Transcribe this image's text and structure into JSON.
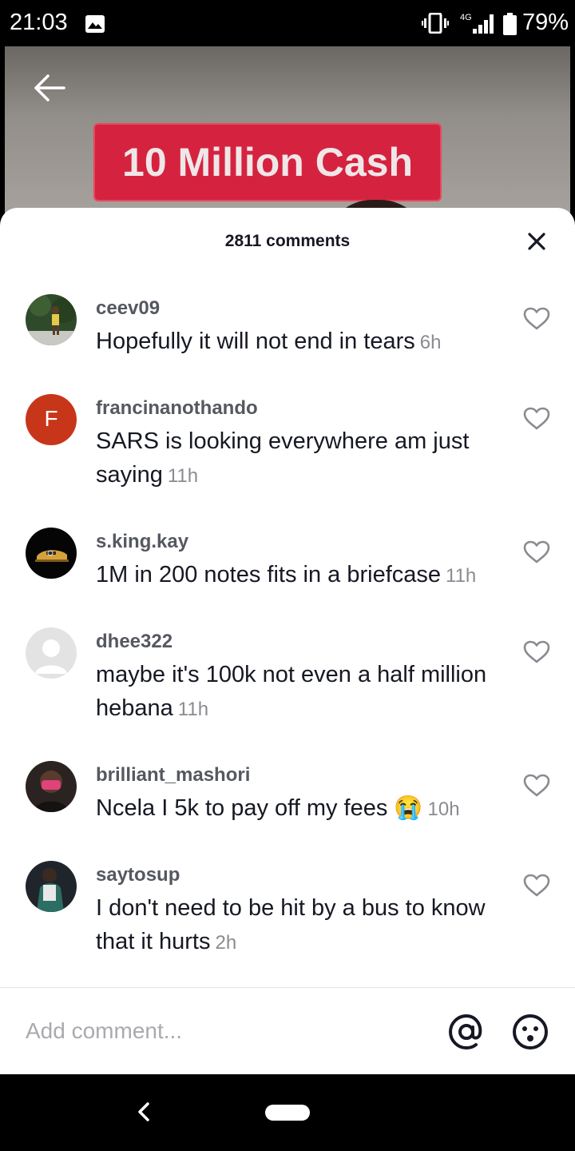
{
  "status_bar": {
    "time": "21:03",
    "network": "4G",
    "battery": "79%"
  },
  "video": {
    "banner_text": "10 Million Cash"
  },
  "comments_header": {
    "title": "2811 comments"
  },
  "comments": [
    {
      "username": "ceev09",
      "text": "Hopefully it will not end in tears",
      "time": "6h",
      "avatar": "photo-green",
      "avatar_initial": ""
    },
    {
      "username": "francinanothando",
      "text": "SARS is looking everywhere am just saying",
      "time": "11h",
      "avatar": "initial",
      "avatar_initial": "F"
    },
    {
      "username": "s.king.kay",
      "text": "1M in 200 notes fits in a briefcase",
      "time": "11h",
      "avatar": "photo-car",
      "avatar_initial": ""
    },
    {
      "username": "dhee322",
      "text": "maybe it's 100k not even a half million hebana",
      "time": "11h",
      "avatar": "default",
      "avatar_initial": ""
    },
    {
      "username": "brilliant_mashori",
      "text": "Ncela I 5k to pay off my fees 😭",
      "time": "10h",
      "avatar": "photo-pink",
      "avatar_initial": ""
    },
    {
      "username": "saytosup",
      "text": "I don't need to be hit by a bus to know that it hurts",
      "time": "2h",
      "avatar": "photo-dark",
      "avatar_initial": ""
    }
  ],
  "input": {
    "placeholder": "Add comment..."
  },
  "colors": {
    "banner": "#d5233f",
    "initial_avatar": "#c8361a",
    "text": "#161823",
    "muted": "#8a8b91"
  }
}
